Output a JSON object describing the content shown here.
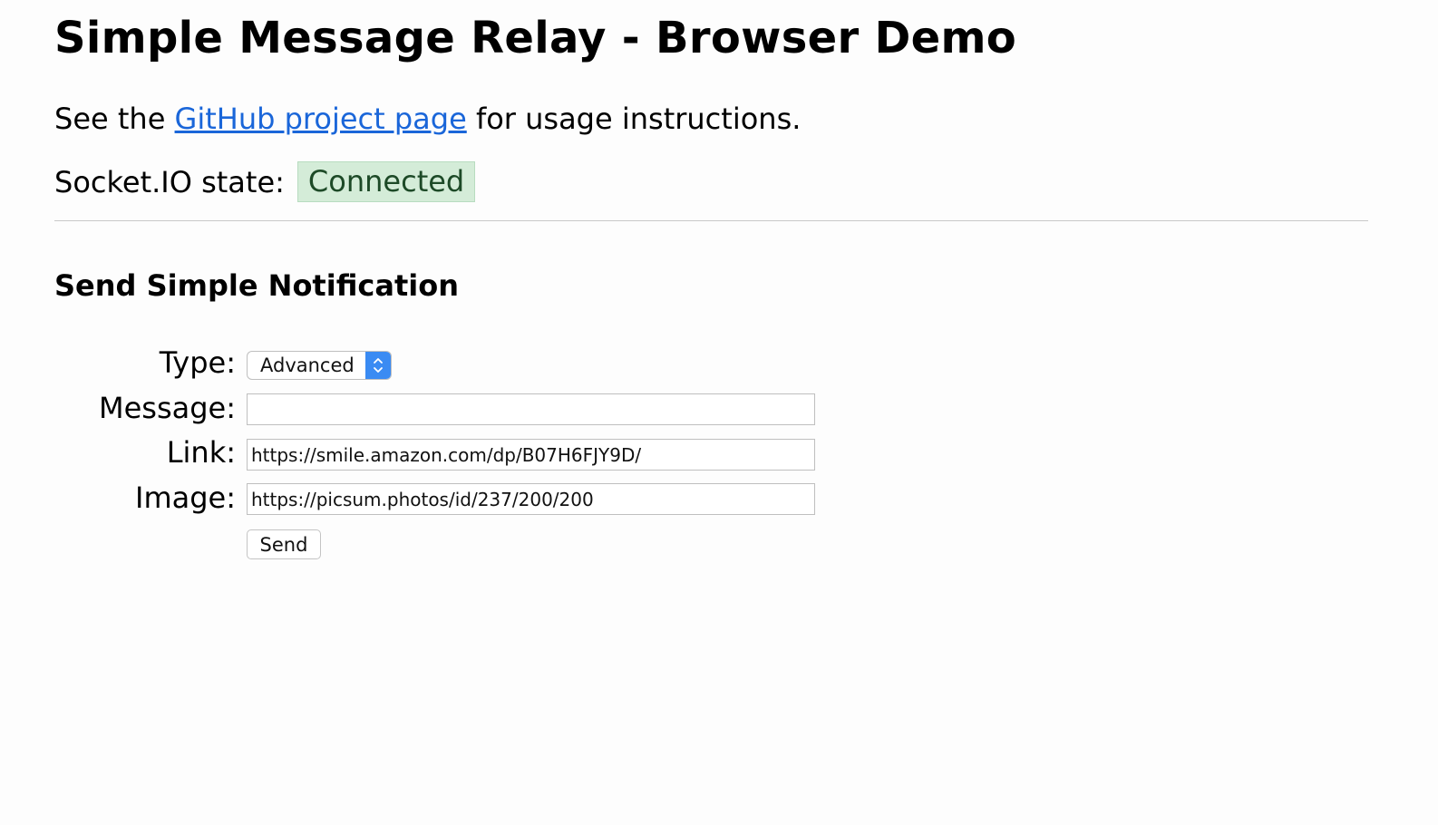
{
  "header": {
    "title": "Simple Message Relay - Browser Demo"
  },
  "intro": {
    "prefix": "See the",
    "link_label": "GitHub project page",
    "suffix": "for usage instructions."
  },
  "status": {
    "label": "Socket.IO state:",
    "value": "Connected",
    "badge_bg": "#d4ecd8",
    "badge_text_color": "#1d4a27"
  },
  "form": {
    "title": "Send Simple Notification",
    "type": {
      "label": "Type:",
      "selected": "Advanced"
    },
    "message": {
      "label": "Message:",
      "value": ""
    },
    "link": {
      "label": "Link:",
      "value": "https://smile.amazon.com/dp/B07H6FJY9D/"
    },
    "image": {
      "label": "Image:",
      "value": "https://picsum.photos/id/237/200/200"
    },
    "send_label": "Send"
  },
  "colors": {
    "link": "#1a66d9",
    "select_accent": "#3a8bf3"
  }
}
